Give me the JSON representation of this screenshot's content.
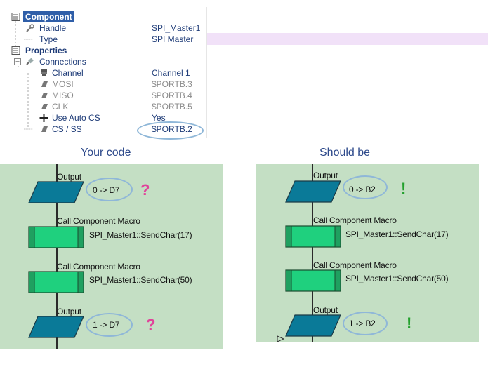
{
  "properties": {
    "component_header": "Component",
    "handle_label": "Handle",
    "handle_value": "SPI_Master1",
    "type_label": "Type",
    "type_value": "SPI Master",
    "properties_header": "Properties",
    "connections_label": "Connections",
    "channel_label": "Channel",
    "channel_value": "Channel 1",
    "mosi_label": "MOSI",
    "mosi_value": "$PORTB.3",
    "miso_label": "MISO",
    "miso_value": "$PORTB.4",
    "clk_label": "CLK",
    "clk_value": "$PORTB.5",
    "autocs_label": "Use Auto CS",
    "autocs_value": "Yes",
    "csss_label": "CS / SS",
    "csss_value": "$PORTB.2"
  },
  "captions": {
    "left": "Your code",
    "right": "Should be"
  },
  "left": {
    "output1_label": "Output",
    "output1_expr": "0 -> D7",
    "output1_mark": "?",
    "macro1_label": "Call Component Macro",
    "macro1_expr": "SPI_Master1::SendChar(17)",
    "macro2_label": "Call Component Macro",
    "macro2_expr": "SPI_Master1::SendChar(50)",
    "output2_label": "Output",
    "output2_expr": "1 -> D7",
    "output2_mark": "?"
  },
  "right": {
    "output1_label": "Output",
    "output1_expr": "0 -> B2",
    "output1_mark": "!",
    "macro1_label": "Call Component Macro",
    "macro1_expr": "SPI_Master1::SendChar(17)",
    "macro2_label": "Call Component Macro",
    "macro2_expr": "SPI_Master1::SendChar(50)",
    "output2_label": "Output",
    "output2_expr": "1 -> B2",
    "output2_mark": "!"
  },
  "colors": {
    "panel_bg": "#c4dfc4",
    "output_fill": "#0a7a98",
    "macro_fill": "#1fd07e",
    "highlight_ellipse": "#8fb7d8",
    "question_mark": "#e0439a",
    "exclamation_mark": "#22a02c"
  }
}
